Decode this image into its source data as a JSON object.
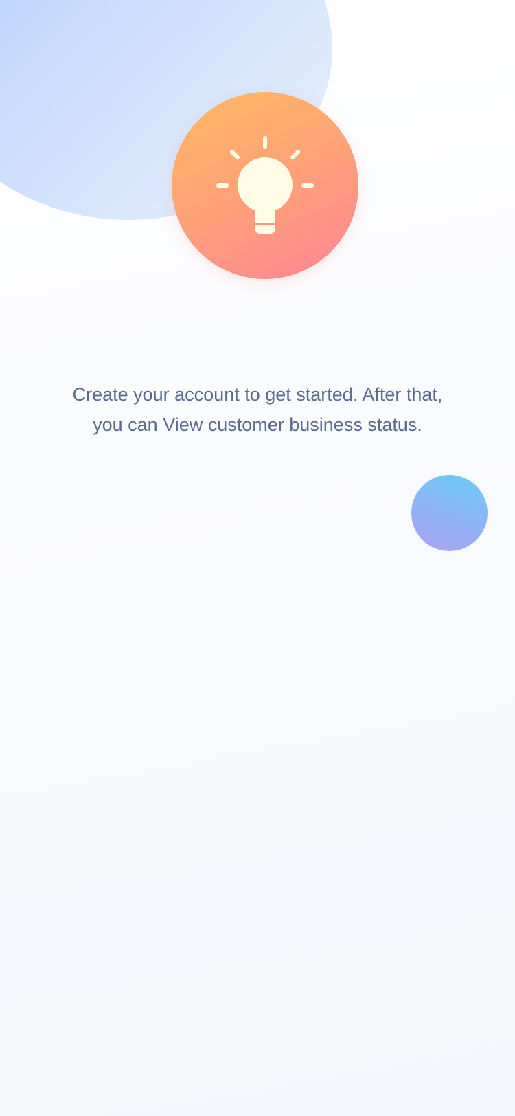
{
  "welcome": {
    "icon": "lightbulb-icon",
    "message_line1": "Create your account to get started. After that,",
    "message_line2": "you can View customer business status."
  },
  "colors": {
    "blob_large": "#c9dcfb",
    "hero_start": "#ffba63",
    "hero_end": "#ff8496",
    "blob_small_start": "#aea2f3",
    "blob_small_end": "#67cdf5",
    "text": "#5b6b8f"
  }
}
